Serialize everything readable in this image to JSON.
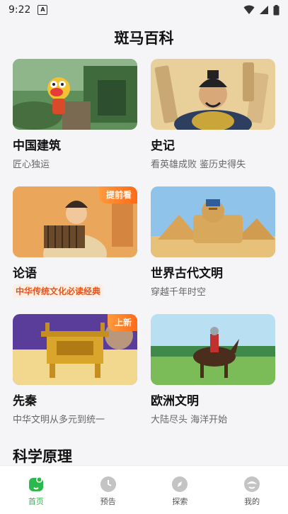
{
  "status": {
    "time": "9:22",
    "app_badge": "A"
  },
  "header": {
    "title": "斑马百科"
  },
  "cards": [
    {
      "title": "中国建筑",
      "subtitle": "匠心独运",
      "badge": ""
    },
    {
      "title": "史记",
      "subtitle": "看英雄成败 鉴历史得失",
      "badge": ""
    },
    {
      "title": "论语",
      "subtitle": "中华传统文化必读经典",
      "badge": "提前看"
    },
    {
      "title": "世界古代文明",
      "subtitle": "穿越千年时空",
      "badge": ""
    },
    {
      "title": "先秦",
      "subtitle": "中华文明从多元到统一",
      "badge": "上新"
    },
    {
      "title": "欧洲文明",
      "subtitle": "大陆尽头 海洋开始",
      "badge": ""
    }
  ],
  "section": {
    "title": "科学原理"
  },
  "tabs": [
    {
      "label": "首页",
      "active": true
    },
    {
      "label": "预告",
      "active": false
    },
    {
      "label": "探索",
      "active": false
    },
    {
      "label": "我的",
      "active": false
    }
  ],
  "colors": {
    "accent": "#2db84d",
    "badge": "#ff7a25",
    "highlight": "#e8541b"
  }
}
